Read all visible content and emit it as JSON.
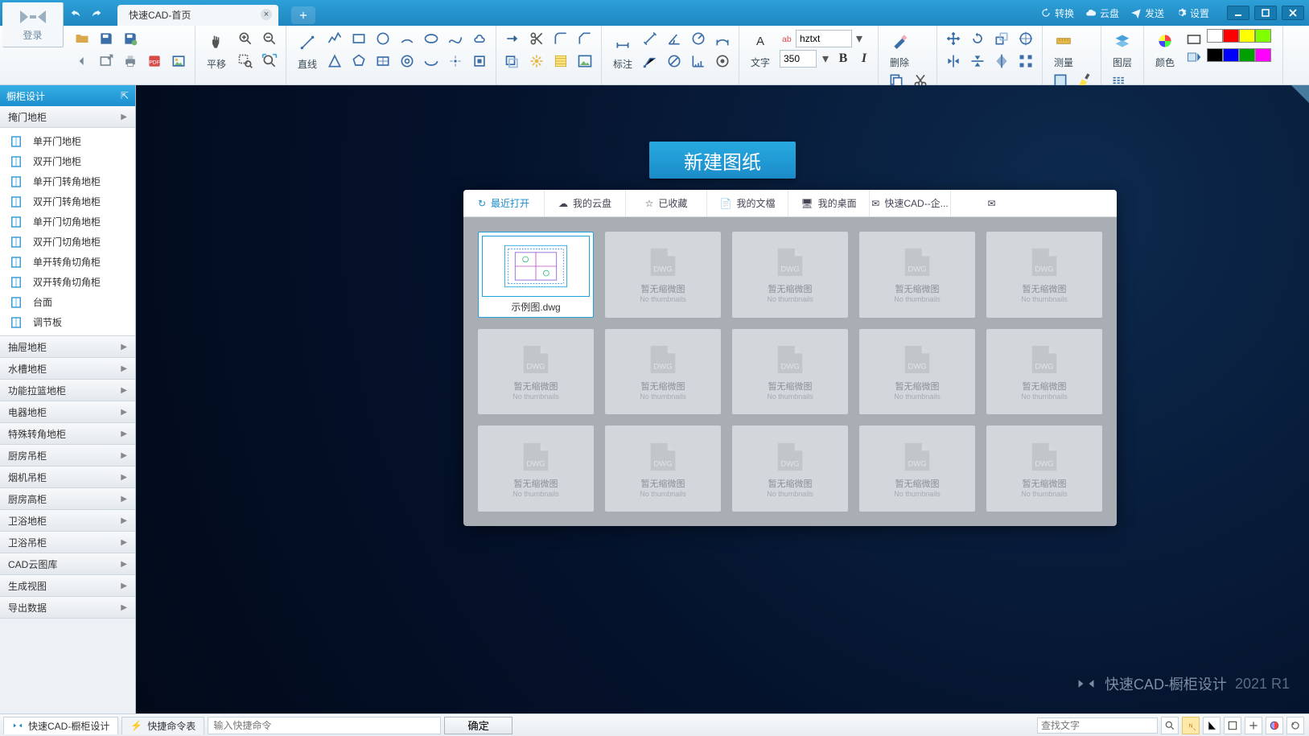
{
  "title_tab": "快速CAD-首页",
  "login_label": "登录",
  "title_links": {
    "convert": "转换",
    "cloud": "云盘",
    "send": "发送",
    "settings": "设置"
  },
  "ribbon": {
    "pan": "平移",
    "line": "直线",
    "dim": "标注",
    "text": "文字",
    "font_field": "hztxt",
    "size_field": "350",
    "delete": "删除",
    "measure": "测量",
    "layer": "图层",
    "color": "颜色"
  },
  "swatches": [
    "#ffffff",
    "#ff0000",
    "#ffff00",
    "#80ff00",
    "#000000",
    "#0000ff",
    "#00a000",
    "#ff00ff"
  ],
  "left": {
    "panel_title": "橱柜设计",
    "cat_open": "掩门地柜",
    "items": [
      "单开门地柜",
      "双开门地柜",
      "单开门转角地柜",
      "双开门转角地柜",
      "单开门切角地柜",
      "双开门切角地柜",
      "单开转角切角柜",
      "双开转角切角柜",
      "台面",
      "调节板"
    ],
    "cats": [
      "抽屉地柜",
      "水槽地柜",
      "功能拉篮地柜",
      "电器地柜",
      "特殊转角地柜",
      "厨房吊柜",
      "烟机吊柜",
      "厨房高柜",
      "卫浴地柜",
      "卫浴吊柜",
      "CAD云图库",
      "生成视图",
      "导出数据"
    ]
  },
  "home": {
    "new_btn": "新建图纸",
    "tabs": [
      "最近打开",
      "我的云盘",
      "已收藏",
      "我的文檔",
      "我的桌面",
      "快速CAD--企..."
    ],
    "file_name": "示例图.dwg",
    "placeholder_t": "暂无缩微图",
    "placeholder_s": "No thumbnails"
  },
  "status": {
    "left_tab": "快速CAD-橱柜设计",
    "cmd_tab": "快捷命令表",
    "cmd_placeholder": "输入快捷命令",
    "ok": "确定",
    "search_placeholder": "查找文字"
  },
  "watermark": {
    "txt": "快速CAD-橱柜设计",
    "year": "2021 R1"
  }
}
